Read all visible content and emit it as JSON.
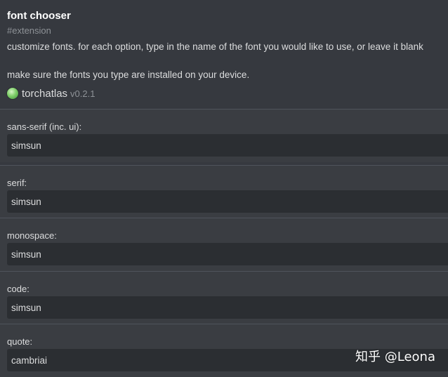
{
  "extension": {
    "title": "font chooser",
    "tag": "#extension",
    "description_line1": "customize fonts. for each option, type in the name of the font you would like to use, or leave it blank",
    "description_line2": "make sure the fonts you type are installed on your device.",
    "author": "torchatlas",
    "version": "v0.2.1"
  },
  "fields": [
    {
      "label": "sans-serif (inc. ui):",
      "value": "simsun"
    },
    {
      "label": "serif:",
      "value": "simsun"
    },
    {
      "label": "monospace:",
      "value": "simsun"
    },
    {
      "label": "code:",
      "value": "simsun"
    },
    {
      "label": "quote:",
      "value": "cambriai"
    }
  ],
  "watermark": "知乎 @Leona",
  "colors": {
    "background": "#36393f",
    "input_background": "#2b2e32",
    "divider": "#4f545c",
    "muted_text": "#8e9297"
  }
}
